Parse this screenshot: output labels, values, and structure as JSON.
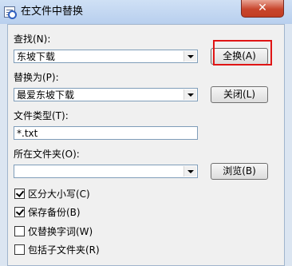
{
  "window": {
    "title": "在文件中替换",
    "close_glyph": "✕"
  },
  "find": {
    "label": "查找(N):",
    "value": "东坡下载"
  },
  "replace": {
    "label": "替换为(P):",
    "value": "最爱东坡下载"
  },
  "filetype": {
    "label": "文件类型(T):",
    "value": "*.txt"
  },
  "folder": {
    "label": "所在文件夹(O):",
    "value": ""
  },
  "buttons": {
    "replace_all": "全换(A)",
    "close": "关闭(L)",
    "browse": "浏览(B)"
  },
  "options": [
    {
      "label": "区分大小写(C)",
      "checked": true
    },
    {
      "label": "保存备份(B)",
      "checked": true
    },
    {
      "label": "仅替换字词(W)",
      "checked": false
    },
    {
      "label": "包括子文件夹(R)",
      "checked": false
    }
  ],
  "colors": {
    "highlight": "#e01515",
    "close_button": "#c8452c"
  }
}
